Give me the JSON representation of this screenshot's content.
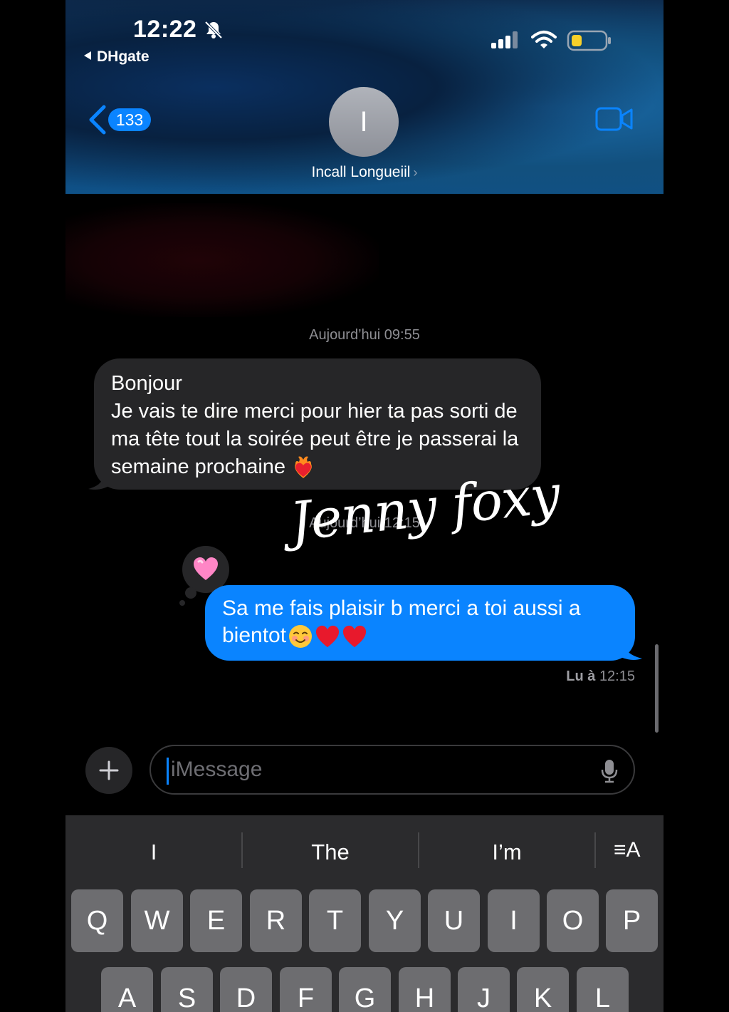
{
  "status": {
    "time": "12:22",
    "back_app": "DHgate"
  },
  "header": {
    "unread_count": "133",
    "avatar_initial": "I",
    "contact_name": "Incall Longueiil"
  },
  "messages": {
    "timestamp1": "Aujourd’hui 09:55",
    "incoming_text": "Bonjour\nJe vais te dire merci pour hier ta pas sorti de ma tête tout la soirée peut être je passerai la semaine prochaine",
    "timestamp2": "Aujourd’hui 12:15",
    "outgoing_text": "Sa me fais plaisir b merci a toi aussi a bientot",
    "read_label": "Lu à",
    "read_time": "12:15"
  },
  "watermark": "Jenny foxy",
  "input": {
    "placeholder": "iMessage"
  },
  "keyboard": {
    "suggestions": [
      "I",
      "The",
      "I’m"
    ],
    "row1": [
      "Q",
      "W",
      "E",
      "R",
      "T",
      "Y",
      "U",
      "I",
      "O",
      "P"
    ],
    "row2": [
      "A",
      "S",
      "D",
      "F",
      "G",
      "H",
      "J",
      "K",
      "L"
    ]
  },
  "colors": {
    "imessage_blue": "#0a84ff",
    "incoming_bubble": "#262628",
    "keyboard_bg": "#2b2b2d",
    "key_bg": "#6d6d70"
  }
}
